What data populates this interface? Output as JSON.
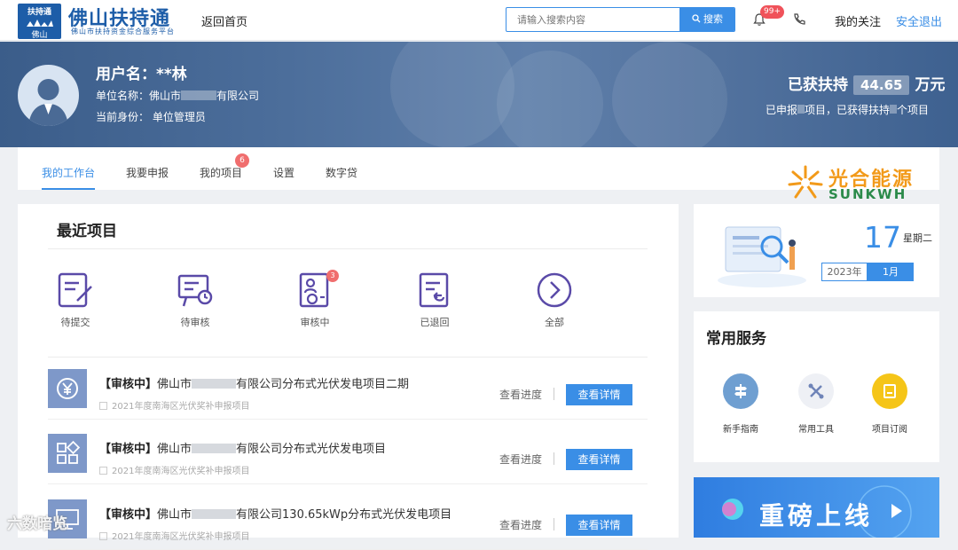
{
  "header": {
    "logo_small_1": "扶持通",
    "logo_small_2": "佛山",
    "logo_title": "佛山扶持通",
    "logo_subtitle": "佛山市扶持资金综合服务平台",
    "back_home": "返回首页",
    "search_placeholder": "请输入搜索内容",
    "search_button": "搜索",
    "notification_badge": "99+",
    "my_follow": "我的关注",
    "logout": "安全退出"
  },
  "profile": {
    "username": "用户名：**林",
    "unit_label": "单位名称：佛山市",
    "unit_suffix": "有限公司",
    "role": "当前身份：   单位管理员",
    "support_prefix": "已获扶持",
    "support_amount": "44.65",
    "support_unit": "万元",
    "support_desc_1": "已申报",
    "support_desc_2": "项目，已获得扶持",
    "support_desc_3": "个项目"
  },
  "tabs": [
    {
      "label": "我的工作台",
      "active": true
    },
    {
      "label": "我要申报"
    },
    {
      "label": "我的项目",
      "badge": "6"
    },
    {
      "label": "设置"
    },
    {
      "label": "数字贷"
    }
  ],
  "brand": {
    "title": "光合能源",
    "subtitle": "SUNKWH"
  },
  "recent": {
    "title": "最近项目",
    "stats": [
      {
        "label": "待提交",
        "icon": "edit-doc-icon"
      },
      {
        "label": "待审核",
        "icon": "pending-board-icon"
      },
      {
        "label": "审核中",
        "icon": "reviewing-icon",
        "badge": "3"
      },
      {
        "label": "已退回",
        "icon": "returned-doc-icon"
      },
      {
        "label": "全部",
        "icon": "chevron-right-icon"
      }
    ],
    "projects": [
      {
        "status": "【审核中】",
        "prefix": "佛山市",
        "suffix": "有限公司分布式光伏发电项目二期",
        "sub": "2021年度南海区光伏奖补申报项目",
        "icon": "yen-icon"
      },
      {
        "status": "【审核中】",
        "prefix": "佛山市",
        "suffix": "有限公司分布式光伏发电项目",
        "sub": "2021年度南海区光伏奖补申报项目",
        "icon": "grid-icon"
      },
      {
        "status": "【审核中】",
        "prefix": "佛山市",
        "suffix": "有限公司130.65kWp分布式光伏发电项目",
        "sub": "2021年度南海区光伏奖补申报项目",
        "icon": "monitor-icon"
      }
    ],
    "progress_label": "查看进度",
    "detail_label": "查看详情"
  },
  "calendar": {
    "day": "17",
    "weekday": "星期二",
    "year": "2023年",
    "month": "1月"
  },
  "services": {
    "title": "常用服务",
    "items": [
      {
        "label": "新手指南",
        "color": "#6f9fd1"
      },
      {
        "label": "常用工具",
        "color": "#eef0f5"
      },
      {
        "label": "项目订阅",
        "color": "#f5c518"
      }
    ]
  },
  "promo": {
    "text": "重磅上线"
  },
  "watermark": "六数暗览",
  "colors": {
    "primary": "#3a8ee6",
    "brand": "#1d5da8",
    "badge": "#f06e6e"
  }
}
